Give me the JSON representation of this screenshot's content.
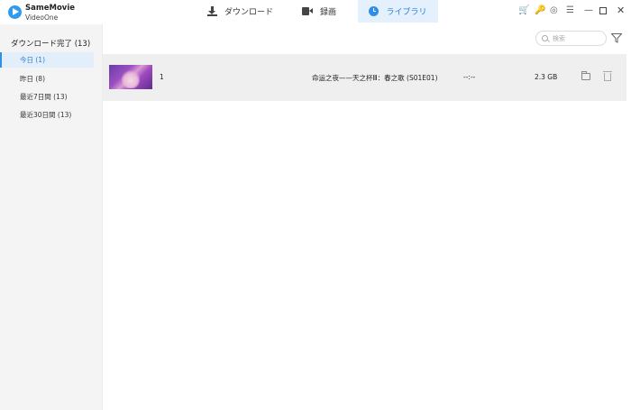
{
  "app": {
    "name_line1": "SameMovie",
    "name_line2": "VideoOne"
  },
  "tabs": [
    {
      "label": "ダウンロード",
      "icon": "download-icon",
      "active": false
    },
    {
      "label": "録画",
      "icon": "video-camera-icon",
      "active": false
    },
    {
      "label": "ライブラリ",
      "icon": "clock-icon",
      "active": true
    }
  ],
  "window_controls": {
    "cart": "🛒",
    "key": "🔑",
    "settings": "◎",
    "menu": "☰",
    "minimize": "—",
    "close": "✕"
  },
  "sidebar": {
    "header": "ダウンロード完了 (13)",
    "items": [
      {
        "label": "今日 (1)",
        "active": true
      },
      {
        "label": "昨日 (8)",
        "active": false
      },
      {
        "label": "最近7日間 (13)",
        "active": false
      },
      {
        "label": "最近30日間 (13)",
        "active": false
      }
    ]
  },
  "search": {
    "placeholder": "検索"
  },
  "rows": [
    {
      "index": "1",
      "title": "命运之夜——天之杯Ⅲ：春之歌 (S01E01)",
      "duration": "--:--",
      "size": "2.3 GB"
    }
  ],
  "colors": {
    "accent": "#2f8fe8",
    "active_tab_bg": "#e4f1fd",
    "sidebar_bg": "#f4f4f4",
    "row_bg": "#efefef",
    "icon_orange": "#f08a24"
  }
}
